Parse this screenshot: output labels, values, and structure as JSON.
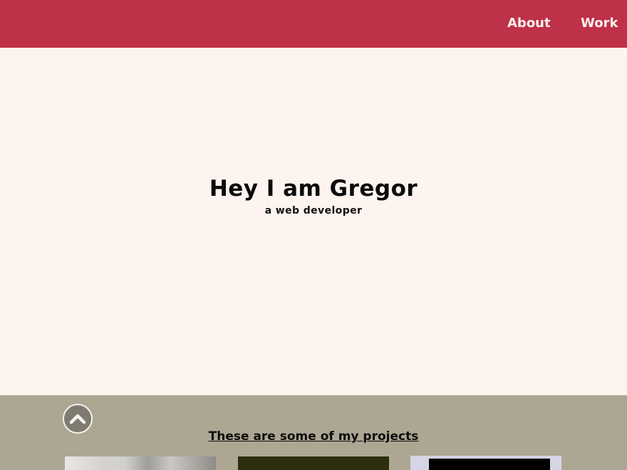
{
  "nav": {
    "links": [
      "About",
      "Work"
    ]
  },
  "hero": {
    "title": "Hey I am Gregor",
    "subtitle": "a web developer"
  },
  "projects": {
    "heading": "These are some of my projects",
    "scroll_top_icon": "chevron-up-icon"
  },
  "colors": {
    "navbar": "#be3148",
    "hero_background": "#fdf3ef",
    "projects_background": "#ada693"
  }
}
